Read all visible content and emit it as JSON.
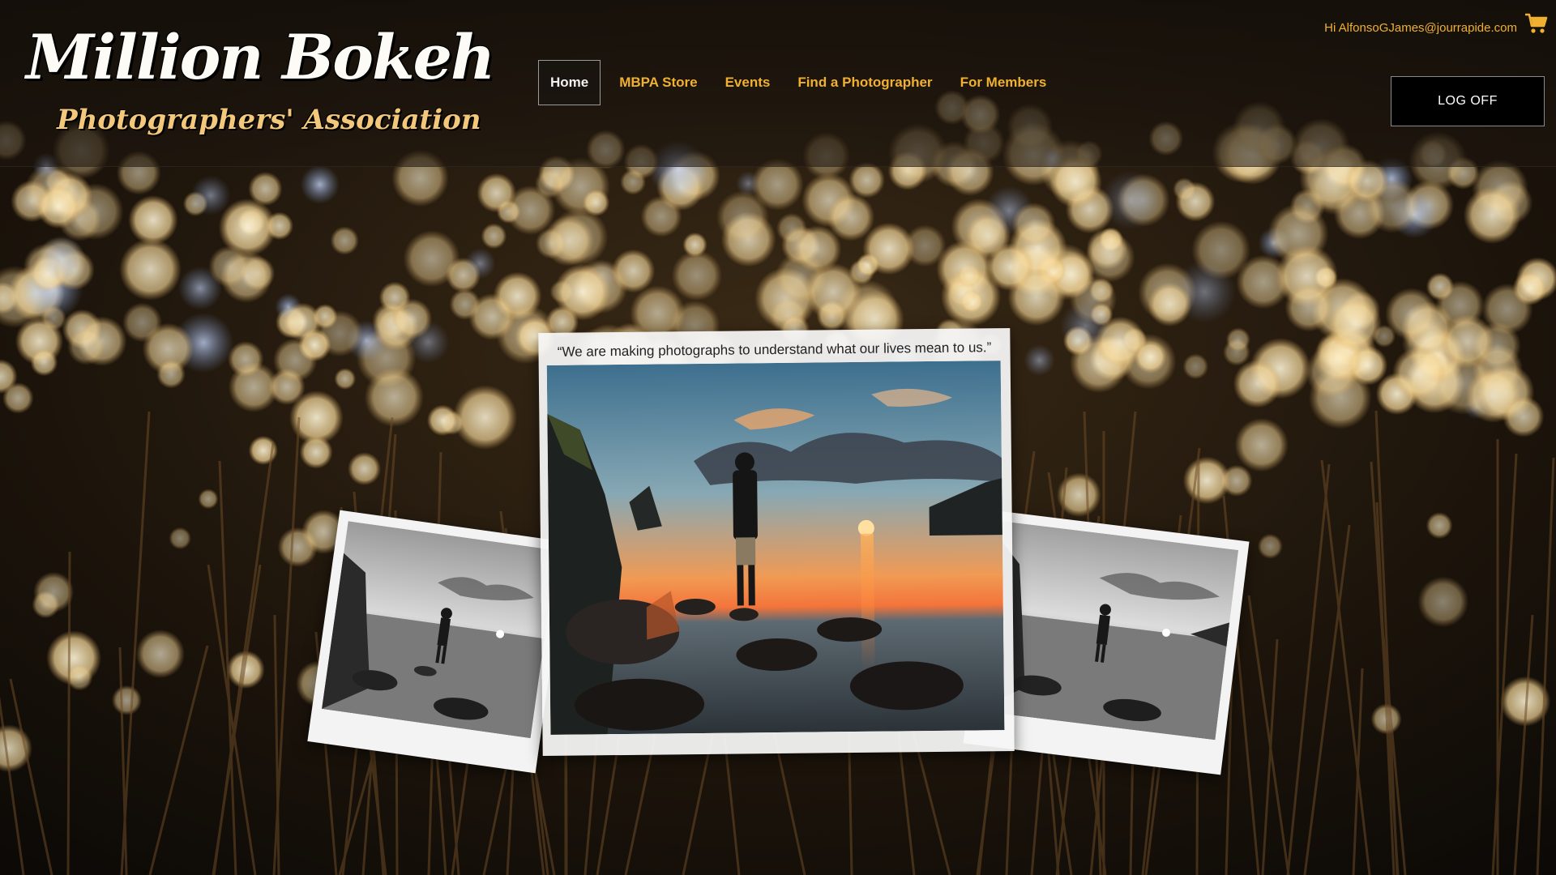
{
  "site": {
    "logo_title": "Million Bokeh",
    "logo_subtitle": "Photographers' Association"
  },
  "nav": {
    "items": [
      {
        "label": "Home",
        "active": true
      },
      {
        "label": "MBPA Store",
        "active": false
      },
      {
        "label": "Events",
        "active": false
      },
      {
        "label": "Find a Photographer",
        "active": false
      },
      {
        "label": "For Members",
        "active": false
      }
    ]
  },
  "user": {
    "greeting": "Hi AlfonsoGJames@jourrapide.com",
    "cart_icon": "shopping-cart-icon",
    "logoff_label": "LOG OFF"
  },
  "gallery": {
    "quote": "“We are making photographs to understand what our lives mean to us.”"
  },
  "colors": {
    "accent": "#f0b030",
    "logo_subtitle": "#f4c87a",
    "background": "#0f0b07",
    "button_bg": "#000000"
  }
}
